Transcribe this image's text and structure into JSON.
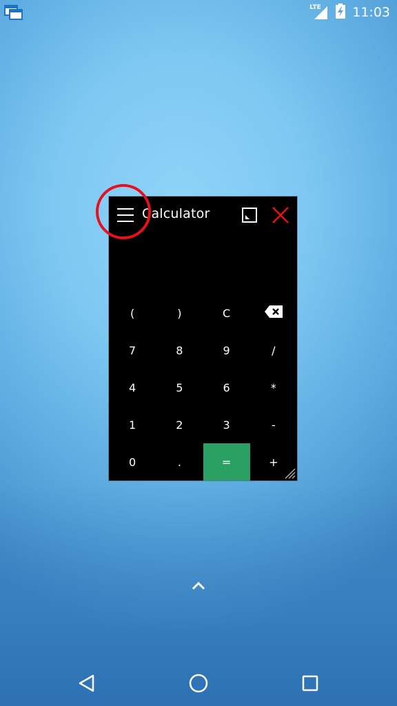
{
  "status_bar": {
    "network": "LTE",
    "time": "11:03"
  },
  "window": {
    "title": "Calculator"
  },
  "keypad": {
    "rows": [
      [
        "(",
        ")",
        "C",
        "⌫"
      ],
      [
        "7",
        "8",
        "9",
        "/"
      ],
      [
        "4",
        "5",
        "6",
        "*"
      ],
      [
        "1",
        "2",
        "3",
        "-"
      ],
      [
        "0",
        ".",
        "=",
        "+"
      ]
    ]
  },
  "colors": {
    "equals_key": "#2aa162",
    "close_icon": "#e8101b",
    "annotation": "#e8101b"
  },
  "icons": {
    "menu": "hamburger-menu-icon",
    "maximize": "maximize-icon",
    "close": "close-icon",
    "backspace": "backspace-icon",
    "nav_back": "back-triangle-icon",
    "nav_home": "home-circle-icon",
    "nav_recents": "recents-square-icon"
  }
}
